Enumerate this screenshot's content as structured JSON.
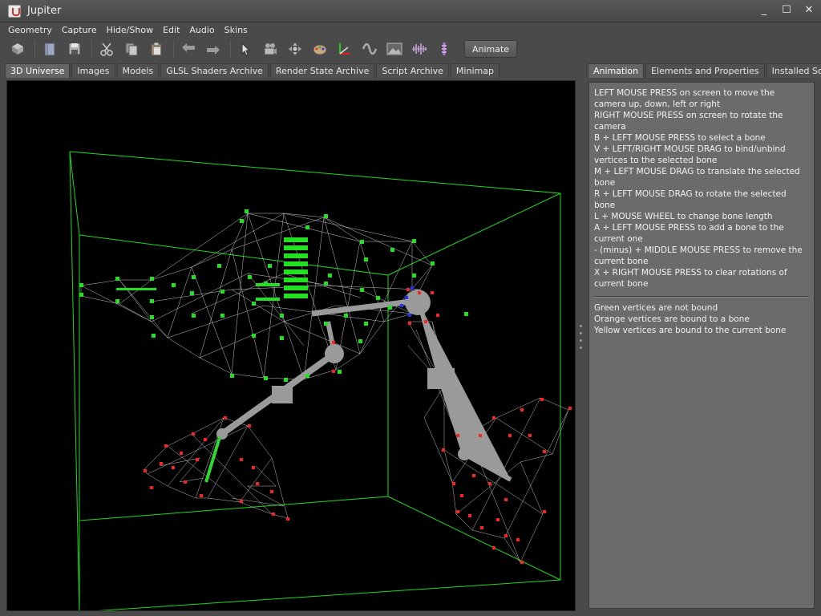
{
  "window": {
    "title": "Jupiter"
  },
  "menu": [
    "Geometry",
    "Capture",
    "Hide/Show",
    "Edit",
    "Audio",
    "Skins"
  ],
  "toolbar": {
    "icons": [
      "cube-icon",
      "book-icon",
      "save-icon",
      "cut-icon",
      "copy-icon",
      "paste-icon",
      "undo-icon",
      "redo-icon",
      "pointer-icon",
      "camera-icon",
      "move-icon",
      "palette-icon",
      "axis-icon",
      "wave-icon",
      "image-icon",
      "audio-icon",
      "bone-icon"
    ],
    "animate_label": "Animate"
  },
  "tabs_left": [
    {
      "label": "3D Universe",
      "active": true
    },
    {
      "label": "Images",
      "active": false
    },
    {
      "label": "Models",
      "active": false
    },
    {
      "label": "GLSL Shaders Archive",
      "active": false
    },
    {
      "label": "Render State Archive",
      "active": false
    },
    {
      "label": "Script Archive",
      "active": false
    },
    {
      "label": "Minimap",
      "active": false
    }
  ],
  "tabs_right": [
    {
      "label": "Animation",
      "active": true
    },
    {
      "label": "Elements and Properties",
      "active": false
    },
    {
      "label": "Installed Scripts",
      "active": false
    }
  ],
  "instructions": [
    "LEFT MOUSE PRESS on screen to move the camera up, down, left or right",
    "RIGHT MOUSE PRESS on screen to rotate the camera",
    "B + LEFT MOUSE PRESS to select a bone",
    "V + LEFT/RIGHT MOUSE DRAG to bind/unbind vertices to the selected bone",
    "M + LEFT MOUSE DRAG to translate the selected bone",
    "R + LEFT MOUSE DRAG to rotate the selected bone",
    "L + MOUSE WHEEL to change bone length",
    "A + LEFT MOUSE PRESS to add a bone to the current one",
    "- (minus) + MIDDLE MOUSE PRESS to remove the current bone",
    "X + RIGHT MOUSE PRESS to clear rotations of current bone"
  ],
  "legend": [
    "Green vertices are not bound",
    "Orange vertices are bound to a bone",
    "Yellow vertices are bound to the current bone"
  ],
  "colors": {
    "unbound_vertex": "#22e022",
    "bound_vertex": "#ff2020",
    "selected_vertex": "#2030ff",
    "bone": "#9a9a9a",
    "bounding_box": "#1fd81f",
    "wire": "#e8e8e8"
  }
}
